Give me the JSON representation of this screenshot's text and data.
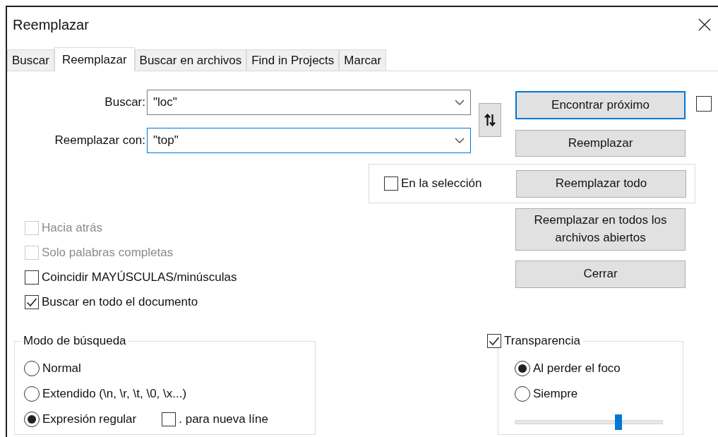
{
  "window": {
    "title": "Reemplazar"
  },
  "tabs": [
    {
      "label": "Buscar",
      "selected": false
    },
    {
      "label": "Reemplazar",
      "selected": true
    },
    {
      "label": "Buscar en archivos",
      "selected": false
    },
    {
      "label": "Find in Projects",
      "selected": false
    },
    {
      "label": "Marcar",
      "selected": false
    }
  ],
  "fields": [
    {
      "label": "Buscar:",
      "value": "\"loc\"",
      "focused": false
    },
    {
      "label": "Reemplazar con:",
      "value": "\"top\"",
      "focused": true
    }
  ],
  "buttons": [
    {
      "label": "Encontrar próximo",
      "focused": true
    },
    {
      "label": "Reemplazar",
      "focused": false
    },
    {
      "label": "Reemplazar todo",
      "focused": false
    },
    {
      "label": "Reemplazar en todos los archivos abiertos",
      "focused": false
    },
    {
      "label": "Cerrar",
      "focused": false
    }
  ],
  "side_checkbox": {
    "checked": false
  },
  "in_selection": {
    "label": "En la selección",
    "checked": false
  },
  "options": [
    {
      "label": "Hacia atrás",
      "checked": false,
      "disabled": true
    },
    {
      "label": "Solo palabras completas",
      "checked": false,
      "disabled": true
    },
    {
      "label": "Coincidir MAYÚSCULAS/minúsculas",
      "checked": false,
      "disabled": false
    },
    {
      "label": "Buscar en todo el documento",
      "checked": true,
      "disabled": false
    }
  ],
  "search_mode": {
    "title": "Modo de búsqueda",
    "options": [
      {
        "label": "Normal",
        "selected": false
      },
      {
        "label": "Extendido (\\n, \\r, \\t, \\0, \\x...)",
        "selected": false
      },
      {
        "label": "Expresión regular",
        "selected": true
      }
    ],
    "dot_newline": {
      "label": ". para nueva líne",
      "checked": false
    }
  },
  "transparency": {
    "label": "Transparencia",
    "checked": true,
    "options": [
      {
        "label": "Al perder el foco",
        "selected": true
      },
      {
        "label": "Siempre",
        "selected": false
      }
    ],
    "slider": {
      "level": 0.7
    }
  }
}
